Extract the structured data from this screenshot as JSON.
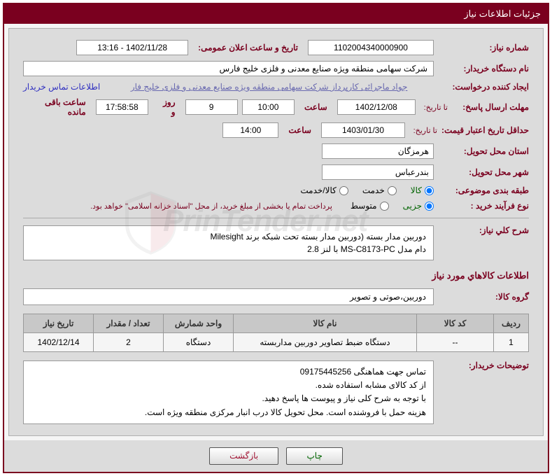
{
  "header": {
    "title": "جزئیات اطلاعات نیاز"
  },
  "fields": {
    "need_number_label": "شماره نیاز:",
    "need_number": "1102004340000900",
    "announce_date_label": "تاریخ و ساعت اعلان عمومی:",
    "announce_date": "1402/11/28 - 13:16",
    "buyer_org_label": "نام دستگاه خریدار:",
    "buyer_org": "شرکت سهامی منطقه ویژه صنایع معدنی و فلزی خلیج فارس",
    "requester_label": "ایجاد کننده درخواست:",
    "requester": "جواد ماجرائی کارپرداز شرکت سهامی منطقه ویژه صنایع معدنی و فلزی خلیج فار",
    "contact_link": "اطلاعات تماس خریدار",
    "response_deadline_label": "مهلت ارسال پاسخ:",
    "ta": "تا تاریخ:",
    "response_date": "1402/12/08",
    "saat": "ساعت",
    "response_time": "10:00",
    "days_val": "9",
    "rooz_va": "روز و",
    "remaining_time": "17:58:58",
    "remaining_label": "ساعت باقی مانده",
    "validity_label": "حداقل تاریخ اعتبار قیمت:",
    "validity_date": "1403/01/30",
    "validity_time": "14:00",
    "delivery_province_label": "استان محل تحویل:",
    "delivery_province": "هرمزگان",
    "delivery_city_label": "شهر محل تحویل:",
    "delivery_city": "بندرعباس",
    "category_label": "طبقه بندی موضوعی:",
    "cat_kala": "کالا",
    "cat_khedmat": "خدمت",
    "cat_kala_khedmat": "کالا/خدمت",
    "process_label": "نوع فرآیند خرید :",
    "proc_jozei": "جزیی",
    "proc_motavaset": "متوسط",
    "payment_note": "پرداخت تمام یا بخشی از مبلغ خرید، از محل \"اسناد خزانه اسلامی\" خواهد بود.",
    "overall_desc_label": "شرح کلي نیاز:",
    "overall_desc_l1": "دوربین مدار بسته (دوربین مدار بسته تحت شبکه برند Milesight",
    "overall_desc_l2": "دام مدل MS-C8173-PC  با لنز 2.8",
    "items_section": "اطلاعات کالاهاي مورد نیاز",
    "group_label": "گروه کالا:",
    "group_value": "دوربین،صوتی و تصویر",
    "table_headers": {
      "row": "ردیف",
      "code": "کد کالا",
      "name": "نام کالا",
      "unit": "واحد شمارش",
      "qty": "تعداد / مقدار",
      "date": "تاریخ نیاز"
    },
    "table_row": {
      "row": "1",
      "code": "--",
      "name": "دستگاه ضبط تصاویر دوربین مداربسته",
      "unit": "دستگاه",
      "qty": "2",
      "date": "1402/12/14"
    },
    "buyer_notes_label": "توضیحات خریدار:",
    "buyer_notes_l1": "تماس جهت هماهنگی 09175445256",
    "buyer_notes_l2": "از کد کالای مشابه استفاده شده.",
    "buyer_notes_l3": "با توجه به شرح کلی نیاز و پیوست ها پاسخ دهید.",
    "buyer_notes_l4": "هزینه حمل با فروشنده است. محل تحویل کالا درب انبار مرکزی منطقه ویژه است."
  },
  "buttons": {
    "print": "چاپ",
    "back": "بازگشت"
  },
  "watermark": "PrinTender.net"
}
